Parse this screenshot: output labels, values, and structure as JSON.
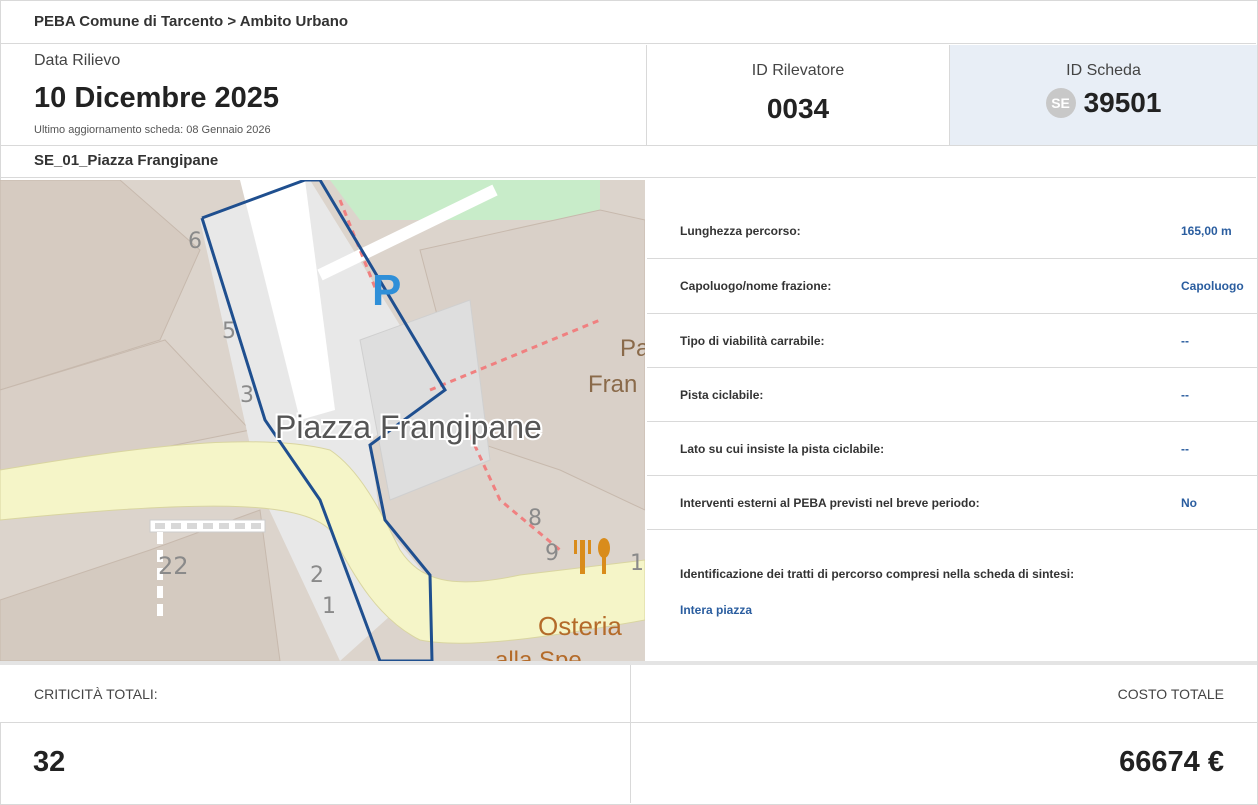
{
  "breadcrumb": "PEBA Comune di Tarcento > Ambito Urbano",
  "header": {
    "date_label": "Data Rilievo",
    "date_value": "10 Dicembre 2025",
    "last_update": "Ultimo aggiornamento scheda: 08 Gennaio 2026",
    "rilevatore_label": "ID Rilevatore",
    "rilevatore_value": "0034",
    "scheda_label": "ID Scheda",
    "scheda_badge": "SE",
    "scheda_value": "39501"
  },
  "section_title": "SE_01_Piazza Frangipane",
  "map": {
    "place_label": "Piazza Frangipane",
    "parking_symbol": "P",
    "poi_label": "Osteria",
    "poi_label_2": "alla Spe",
    "poi_partial_1": "Pa",
    "poi_partial_2": "Fran",
    "house_numbers": [
      "6",
      "5",
      "3",
      "2",
      "1",
      "22",
      "8",
      "9",
      "1"
    ],
    "restaurant_icon": "fork-knife-icon",
    "colors": {
      "route": "#1f4f8f",
      "road": "#f5f5c8",
      "building": "#d9d0c8",
      "square": "#e8e8e8",
      "park": "#c8ecc9"
    }
  },
  "details": [
    {
      "label": "Lunghezza percorso:",
      "value": "165,00 m"
    },
    {
      "label": "Capoluogo/nome frazione:",
      "value": "Capoluogo"
    },
    {
      "label": "Tipo di viabilità carrabile:",
      "value": "--"
    },
    {
      "label": "Pista ciclabile:",
      "value": "--"
    },
    {
      "label": "Lato su cui insiste la pista ciclabile:",
      "value": "--"
    },
    {
      "label": "Interventi esterni al PEBA previsti nel breve periodo:",
      "value": "No"
    },
    {
      "label": "Identificazione dei tratti di percorso compresi nella scheda di sintesi:",
      "value": "Intera piazza"
    }
  ],
  "totals": {
    "criticita_label": "CRITICITÀ TOTALI:",
    "criticita_value": "32",
    "costo_label": "COSTO TOTALE",
    "costo_value": "66674 €"
  },
  "accent_color": "#2a5d9f"
}
